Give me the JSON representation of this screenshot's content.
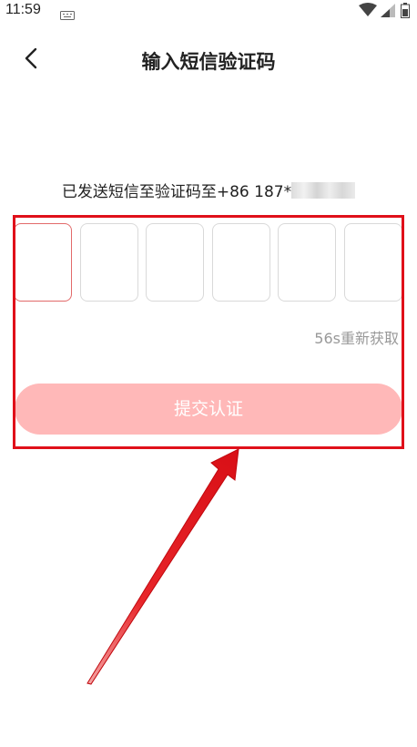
{
  "status_bar": {
    "time": "11:59",
    "icons": [
      "keyboard-icon",
      "wifi-icon",
      "signal-icon",
      "battery-icon"
    ]
  },
  "header": {
    "title": "输入短信验证码",
    "back_icon": "chevron-left-icon"
  },
  "verification": {
    "sent_text": "已发送短信至验证码至+86 187*",
    "code_length": 6,
    "code_values": [
      "",
      "",
      "",
      "",
      "",
      ""
    ],
    "active_index": 0,
    "resend_text": "56s重新获取",
    "submit_label": "提交认证"
  },
  "colors": {
    "accent": "#ffb8b8",
    "active_border": "#e26a6a",
    "annotation": "#e0101a"
  }
}
